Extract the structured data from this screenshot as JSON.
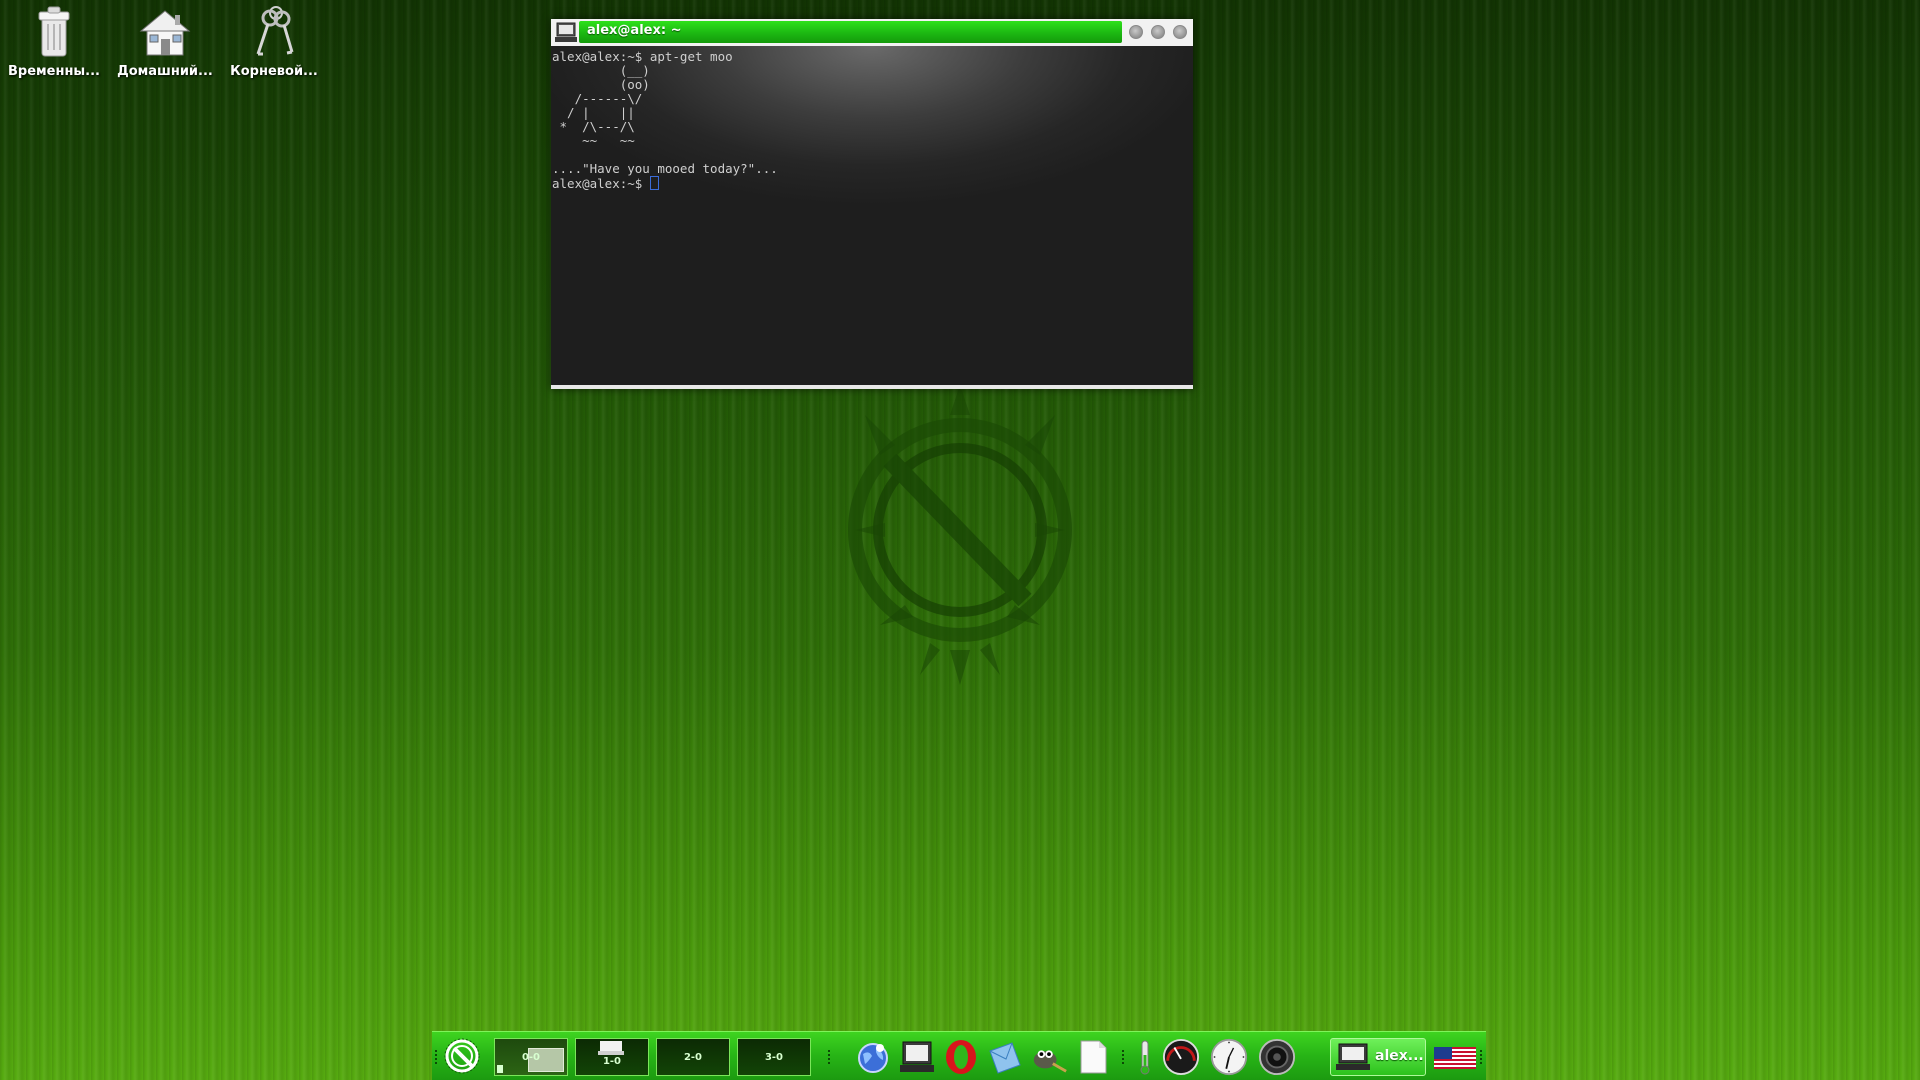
{
  "desktop": {
    "icons": [
      {
        "label": "Временны...",
        "icon": "trash-icon"
      },
      {
        "label": "Домашний...",
        "icon": "home-folder-icon"
      },
      {
        "label": "Корневой...",
        "icon": "root-keys-icon"
      }
    ]
  },
  "terminal": {
    "title": "alex@alex: ~",
    "lines": [
      "alex@alex:~$ apt-get moo",
      "         (__)",
      "         (oo)",
      "   /------\\/",
      "  / |    ||",
      " *  /\\---/\\",
      "    ~~   ~~",
      "....\"Have you mooed today?\"...",
      "alex@alex:~$ "
    ],
    "buttons": [
      "minimize",
      "maximize",
      "close"
    ]
  },
  "taskbar": {
    "workspaces": [
      "0-0",
      "1-0",
      "2-0",
      "3-0"
    ],
    "quick_launch": [
      "browser-globe-icon",
      "terminal-icon",
      "opera-icon",
      "mail-icon",
      "gimp-icon",
      "document-icon"
    ],
    "active_task": "alex...",
    "keyboard_layout": "us-flag-icon",
    "colors": {
      "bar": "#27b416",
      "accent": "#2ee11a"
    }
  }
}
